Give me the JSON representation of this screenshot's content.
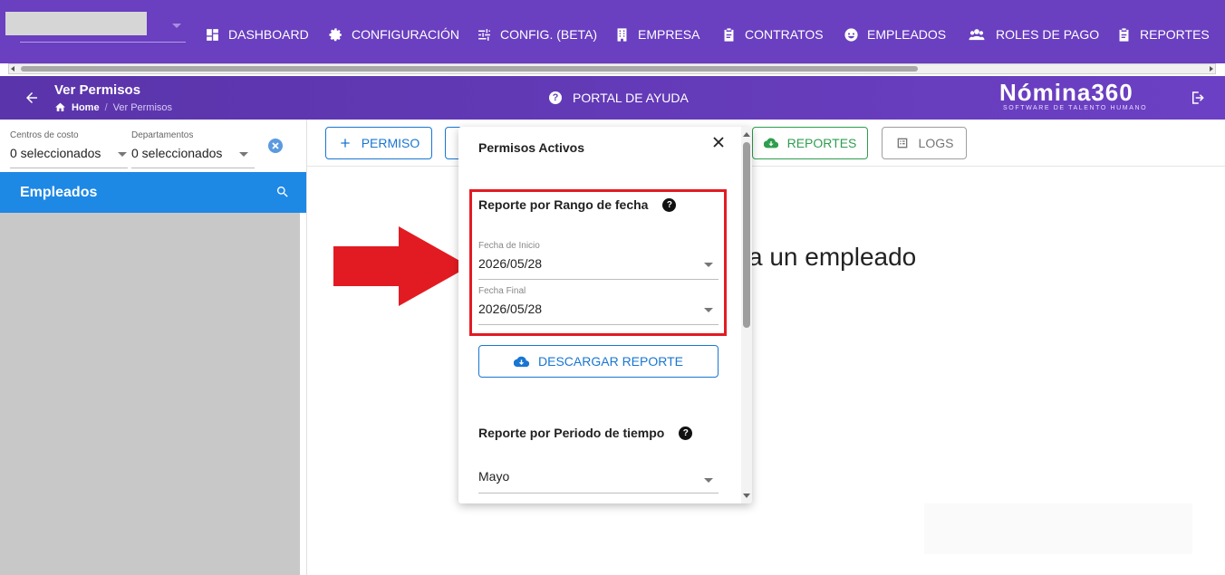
{
  "nav": {
    "items": [
      {
        "label": "DASHBOARD",
        "icon": "dashboard-icon"
      },
      {
        "label": "CONFIGURACIÓN",
        "icon": "gear-icon"
      },
      {
        "label": "CONFIG. (BETA)",
        "icon": "sliders-icon"
      },
      {
        "label": "EMPRESA",
        "icon": "building-icon"
      },
      {
        "label": "CONTRATOS",
        "icon": "clipboard-icon"
      },
      {
        "label": "EMPLEADOS",
        "icon": "face-icon"
      },
      {
        "label": "ROLES DE PAGO",
        "icon": "group-icon"
      },
      {
        "label": "REPORTES",
        "icon": "clipboard-icon"
      }
    ]
  },
  "header": {
    "title": "Ver Permisos",
    "breadcrumb_home": "Home",
    "breadcrumb_current": "Ver Permisos",
    "help_portal": "PORTAL DE AYUDA",
    "logo_name": "Nómina360",
    "logo_tagline": "SOFTWARE DE TALENTO HUMANO"
  },
  "filters": {
    "cost_center_label": "Centros de costo",
    "cost_center_value": "0 seleccionados",
    "department_label": "Departamentos",
    "department_value": "0 seleccionados"
  },
  "employees": {
    "title": "Empleados"
  },
  "toolbar": {
    "add_permiso": "PERMISO",
    "reportes": "REPORTES",
    "logs": "LOGS"
  },
  "main": {
    "placeholder": "a un empleado"
  },
  "popup": {
    "title": "Permisos Activos",
    "range_section_title": "Reporte por Rango de fecha",
    "start_label": "Fecha de Inicio",
    "start_value": "2026/05/28",
    "end_label": "Fecha Final",
    "end_value": "2026/05/28",
    "download_button": "DESCARGAR REPORTE",
    "period_section_title": "Reporte por Periodo de tiempo",
    "period_value": "Mayo"
  },
  "colors": {
    "nav_bg": "#6a3fc0",
    "accent_blue": "#1e88e5",
    "green": "#2e9e4f",
    "highlight_red": "#e21b22"
  }
}
